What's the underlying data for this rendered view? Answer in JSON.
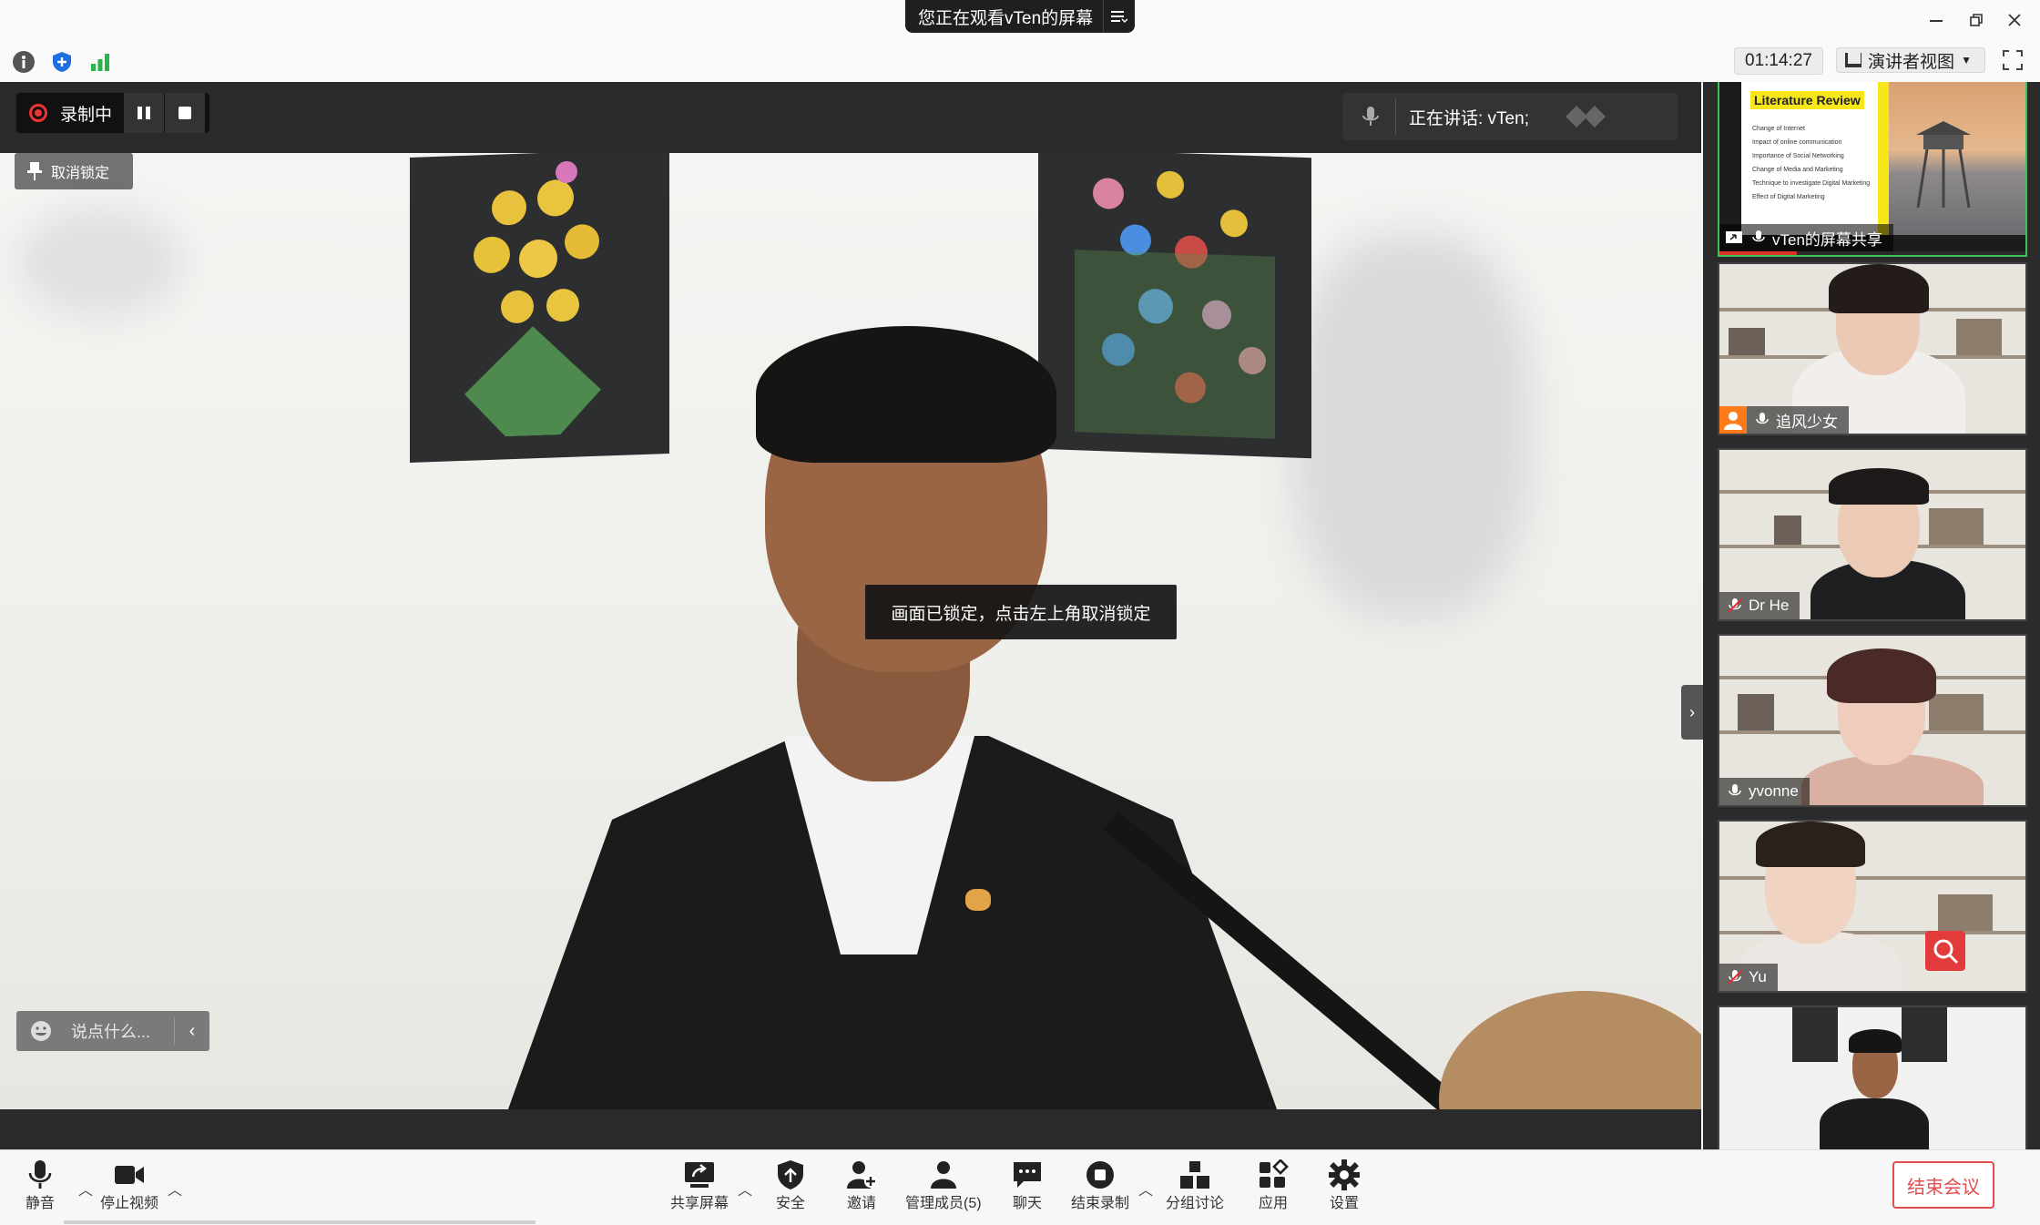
{
  "window": {
    "share_banner": "您正在观看vTen的屏幕",
    "share_menu_icon": "menu-icon"
  },
  "infobar": {
    "timer": "01:14:27",
    "view_mode": "演讲者视图"
  },
  "stage": {
    "recording_label": "录制中",
    "unpin_label": "取消锁定",
    "speaking_label": "正在讲话: vTen;",
    "locked_tip": "画面已锁定，点击左上角取消锁定",
    "say_placeholder": "说点什么..."
  },
  "gallery": {
    "tiles": [
      {
        "name": "vTen的屏幕共享",
        "slide_title": "Literature Review",
        "slide_bullets": [
          "Change of Internet",
          "Impact of online communication",
          "Importance of Social Networking",
          "Change of Media and Marketing",
          "Technique to investigate Digital Marketing",
          "Effect of Digital Marketing"
        ]
      },
      {
        "name": "追风少女"
      },
      {
        "name": "Dr He"
      },
      {
        "name": "yvonne"
      },
      {
        "name": "Yu"
      },
      {
        "name": ""
      }
    ]
  },
  "toolbar": {
    "mute": "静音",
    "stop_video": "停止视频",
    "share_screen": "共享屏幕",
    "security": "安全",
    "invite": "邀请",
    "manage_members": "管理成员(5)",
    "chat": "聊天",
    "end_recording": "结束录制",
    "breakout": "分组讨论",
    "apps": "应用",
    "settings": "设置",
    "end_meeting": "结束会议"
  },
  "colors": {
    "accent_green": "#3cc35a",
    "end_red": "#e24c4c",
    "record_red": "#e33333"
  }
}
